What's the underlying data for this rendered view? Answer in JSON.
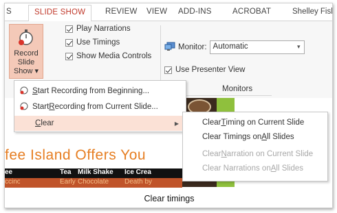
{
  "tabs": {
    "s": "S",
    "slide_show": "SLIDE SHOW",
    "review": "REVIEW",
    "view": "VIEW",
    "add_ins": "ADD-INS",
    "acrobat": "ACROBAT"
  },
  "user": "Shelley Fish",
  "ribbon": {
    "record_btn": {
      "line1": "Record Slide",
      "line2": "Show ▾"
    },
    "play_narrations": "Play Narrations",
    "use_timings": "Use Timings",
    "show_media_controls": "Show Media Controls",
    "monitor_label": "Monitor:",
    "monitor_value": "Automatic",
    "use_presenter_view": "Use Presenter View",
    "monitors_group": "Monitors"
  },
  "menu": {
    "start_beginning": {
      "pre": "",
      "u": "S",
      "post": "tart Recording from Beginning..."
    },
    "start_current": {
      "pre": "Start ",
      "u": "R",
      "post": "ecording from Current Slide..."
    },
    "clear": {
      "pre": "",
      "u": "C",
      "post": "lear"
    }
  },
  "submenu": {
    "clear_timing_current": {
      "pre": "Clear ",
      "u": "T",
      "post": "iming on Current Slide"
    },
    "clear_timings_all": {
      "pre": "Clear Timings on ",
      "u": "A",
      "post": "ll Slides"
    },
    "clear_narration_current": {
      "pre": "Clear ",
      "u": "N",
      "post": "arration on Current Slide"
    },
    "clear_narrations_all": {
      "pre": "Clear Narrations on ",
      "u": "A",
      "post": "ll Slides"
    }
  },
  "slide": {
    "title": "fee Island Offers You",
    "table_head": [
      "ee",
      "Tea",
      "Milk Shake",
      "Ice Crea"
    ],
    "table_row": [
      "ccino",
      "Early Grey",
      "Chocolate",
      "Death by"
    ]
  },
  "caption": "Clear timings",
  "colors": {
    "accent": "#c0392b",
    "record_button_bg": "#f4c9b8",
    "slide_title": "#e67e22",
    "table_row": "#c0542a",
    "green_strip": "#8fc03d"
  }
}
